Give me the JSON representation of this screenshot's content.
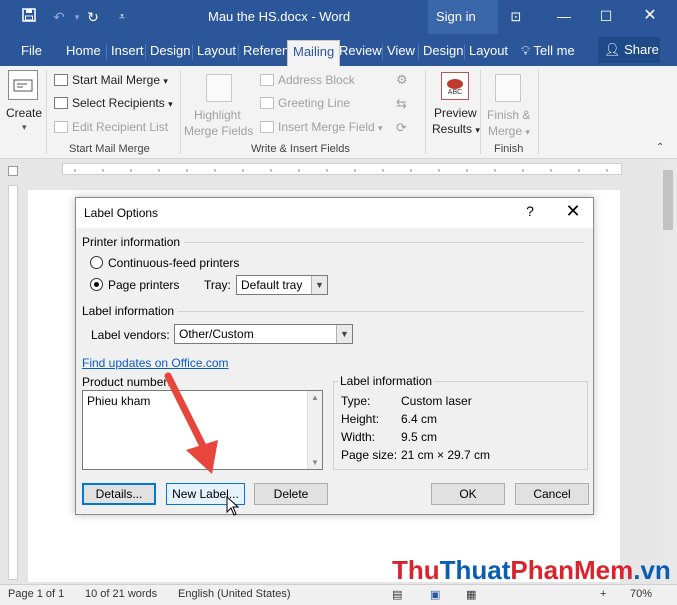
{
  "colors": {
    "accent": "#2b579a",
    "link": "#0b5bc8",
    "arrow": "#e8453c",
    "watermark_red": "#d9232d",
    "watermark_blue": "#0a5db1"
  },
  "window": {
    "title": "Mau the HS.docx  -  Word",
    "sign_in": "Sign in"
  },
  "tabs": [
    "File",
    "Home",
    "Insert",
    "Design",
    "Layout",
    "Referen",
    "Mailing",
    "Review",
    "View",
    "Design",
    "Layout"
  ],
  "tell_me": "Tell me",
  "share": "Share",
  "ribbon": {
    "create": "Create",
    "start_mail_merge": "Start Mail Merge",
    "select_recipients": "Select Recipients",
    "edit_recipient_list": "Edit Recipient List",
    "group_start": "Start Mail Merge",
    "highlight_line1": "Highlight",
    "highlight_line2": "Merge Fields",
    "address_block": "Address Block",
    "greeting_line": "Greeting Line",
    "insert_merge_field": "Insert Merge Field",
    "group_write": "Write & Insert Fields",
    "abc_badge": "ABC",
    "preview_line1": "Preview",
    "preview_line2": "Results",
    "finish_line1": "Finish &",
    "finish_line2": "Merge",
    "group_finish": "Finish"
  },
  "dialog": {
    "title": "Label Options",
    "help": "?",
    "printer_info": "Printer information",
    "continuous_feed": "Continuous-feed printers",
    "page_printers": "Page printers",
    "tray_label": "Tray:",
    "tray_value": "Default tray",
    "label_info_heading": "Label information",
    "label_vendors": "Label vendors:",
    "vendor_value": "Other/Custom",
    "find_updates": "Find updates on Office.com",
    "product_number": "Product number:",
    "product_item": "Phieu  kham",
    "info_box_title": "Label information",
    "info": [
      {
        "key": "Type:",
        "value": "Custom laser"
      },
      {
        "key": "Height:",
        "value": "6.4 cm"
      },
      {
        "key": "Width:",
        "value": "9.5 cm"
      },
      {
        "key": "Page size:",
        "value": "21 cm × 29.7 cm"
      }
    ],
    "buttons": {
      "details": "Details...",
      "new_label": "New Label...",
      "delete": "Delete",
      "ok": "OK",
      "cancel": "Cancel"
    }
  },
  "status": {
    "page": "Page 1 of 1",
    "words": "10 of 21 words",
    "language": "English (United States)",
    "zoom": "70%"
  },
  "watermark": {
    "part1": "Thu",
    "part2": "Thuat",
    "part3": "PhanMem",
    "part4": ".vn"
  }
}
